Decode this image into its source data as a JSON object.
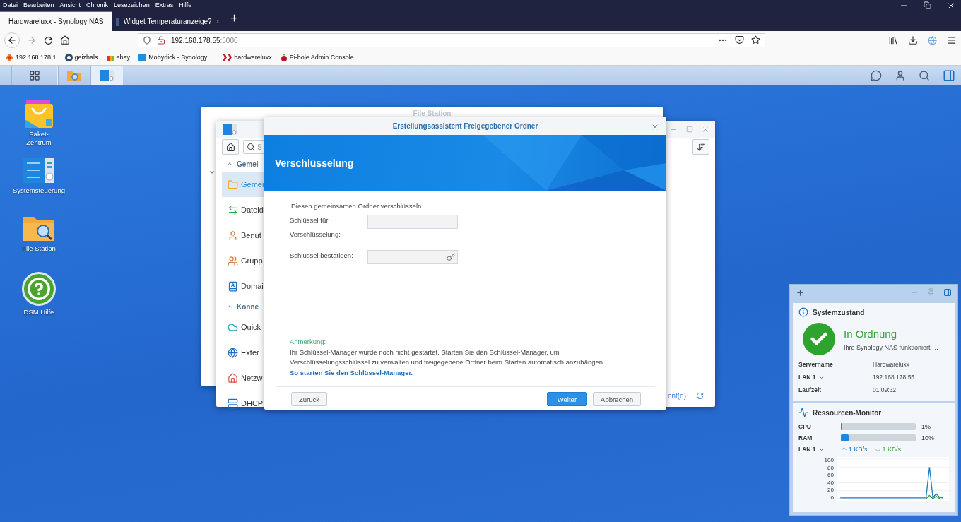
{
  "browser": {
    "menu": [
      "Datei",
      "Bearbeiten",
      "Ansicht",
      "Chronik",
      "Lesezeichen",
      "Extras",
      "Hilfe"
    ],
    "tabs": [
      {
        "title": "Hardwareluxx - Synology NAS",
        "kind": "dsm",
        "selected": true
      },
      {
        "title": "Widget Temperaturanzeige?",
        "kind": "forum",
        "selected": false
      }
    ],
    "address": {
      "host": "192.168.178.55",
      "port": ":5000"
    },
    "bookmarks": [
      {
        "label": "192.168.178.1",
        "kind": "router"
      },
      {
        "label": "geizhals",
        "kind": "ring"
      },
      {
        "label": "ebay",
        "kind": "bag"
      },
      {
        "label": "Mobydick - Synology ...",
        "kind": "dsm"
      },
      {
        "label": "hardwareluxx",
        "kind": "cross"
      },
      {
        "label": "Pi-hole Admin Console",
        "kind": "berry"
      }
    ]
  },
  "dsm_taskbar": {
    "apps": [
      {
        "kind": "main-menu",
        "selected": false
      },
      {
        "kind": "file-station",
        "selected": false
      },
      {
        "kind": "control-panel",
        "selected": true
      }
    ]
  },
  "desktop_icons": [
    {
      "label": "Paket-Zentrum",
      "kind": "package"
    },
    {
      "label": "Systemsteuerung",
      "kind": "control-panel"
    },
    {
      "label": "File Station",
      "kind": "file-station"
    },
    {
      "label": "DSM Hilfe",
      "kind": "help"
    }
  ],
  "file_station_window": {
    "title": "File Station"
  },
  "control_panel_window": {
    "search_text": "S",
    "footer_text": "ent(e)",
    "sections": [
      {
        "title": "Gemei",
        "expanded": true,
        "items": [
          {
            "label": "Gemei",
            "kind": "shared-folder",
            "selected": true
          },
          {
            "label": "Dateid",
            "kind": "file-services",
            "selected": false
          },
          {
            "label": "Benut",
            "kind": "user",
            "selected": false
          },
          {
            "label": "Grupp",
            "kind": "group",
            "selected": false
          },
          {
            "label": "Domai",
            "kind": "domain",
            "selected": false
          }
        ]
      },
      {
        "title": "Konne",
        "expanded": true,
        "items": [
          {
            "label": "Quick",
            "kind": "quickconnect",
            "selected": false
          },
          {
            "label": "Exter",
            "kind": "external",
            "selected": false
          },
          {
            "label": "Netzw",
            "kind": "network",
            "selected": false
          },
          {
            "label": "DHCP",
            "kind": "dhcp",
            "selected": false
          }
        ]
      }
    ]
  },
  "dialog": {
    "title": "Erstellungsassistent Freigegebener Ordner",
    "heading": "Verschlüsselung",
    "encrypt": {
      "label": "Diesen gemeinsamen Ordner verschlüsseln",
      "checked": false
    },
    "fields": [
      {
        "label": "Schlüssel für Verschlüsselung:",
        "kind": "password",
        "disabled": true
      },
      {
        "label": "Schlüssel bestätigen:",
        "kind": "key",
        "disabled": true
      }
    ],
    "note_title": "Anmerkung:",
    "note_text": "Ihr Schlüssel-Manager wurde noch nicht gestartet. Starten Sie den Schlüssel-Manager, um Verschlüsselungsschlüssel zu verwalten und freigegebene Ordner beim Starten automatisch anzuhängen.",
    "note_link": "So starten Sie den Schlüssel-Manager.",
    "buttons": [
      {
        "label": "Zurück",
        "kind": "secondary"
      },
      {
        "label": "Weiter",
        "kind": "primary"
      },
      {
        "label": "Abbrechen",
        "kind": "secondary"
      }
    ]
  },
  "widgets": {
    "system_health": {
      "title": "Systemzustand",
      "status": "In Ordnung",
      "description": "Ihre Synology NAS funktioniert …",
      "rows": [
        {
          "label": "Servername",
          "value": "Hardwareluxx",
          "dropdown": false
        },
        {
          "label": "LAN 1",
          "value": "192.168.178.55",
          "dropdown": true
        },
        {
          "label": "Laufzeit",
          "value": "01:09:32",
          "dropdown": false
        }
      ]
    },
    "resource_monitor": {
      "title": "Ressourcen-Monitor",
      "meters": [
        {
          "name": "CPU",
          "level": 0.01,
          "reading": "1%"
        },
        {
          "name": "RAM",
          "level": 0.1,
          "reading": "10%"
        }
      ],
      "network": {
        "label": "LAN 1",
        "upload": "1 KB/s",
        "download": "1 KB/s"
      },
      "chart_data": {
        "type": "line",
        "ylim": [
          0,
          100
        ],
        "yticks": [
          0,
          20,
          40,
          60,
          80,
          100
        ],
        "grid": true,
        "series": [
          {
            "color": "#1a7bbf",
            "values": [
              2,
              2,
              2,
              2,
              2,
              2,
              2,
              2,
              2,
              2,
              2,
              2,
              2,
              2,
              2,
              2,
              2,
              2,
              2,
              2,
              2,
              2,
              2,
              2,
              2,
              2,
              80,
              3,
              12,
              3,
              2
            ]
          },
          {
            "color": "#3aa63a",
            "values": [
              null,
              null,
              null,
              null,
              null,
              null,
              null,
              null,
              null,
              null,
              null,
              null,
              null,
              null,
              null,
              null,
              null,
              null,
              null,
              null,
              null,
              null,
              null,
              null,
              null,
              0,
              8,
              0,
              6,
              0,
              null
            ]
          }
        ]
      }
    }
  }
}
